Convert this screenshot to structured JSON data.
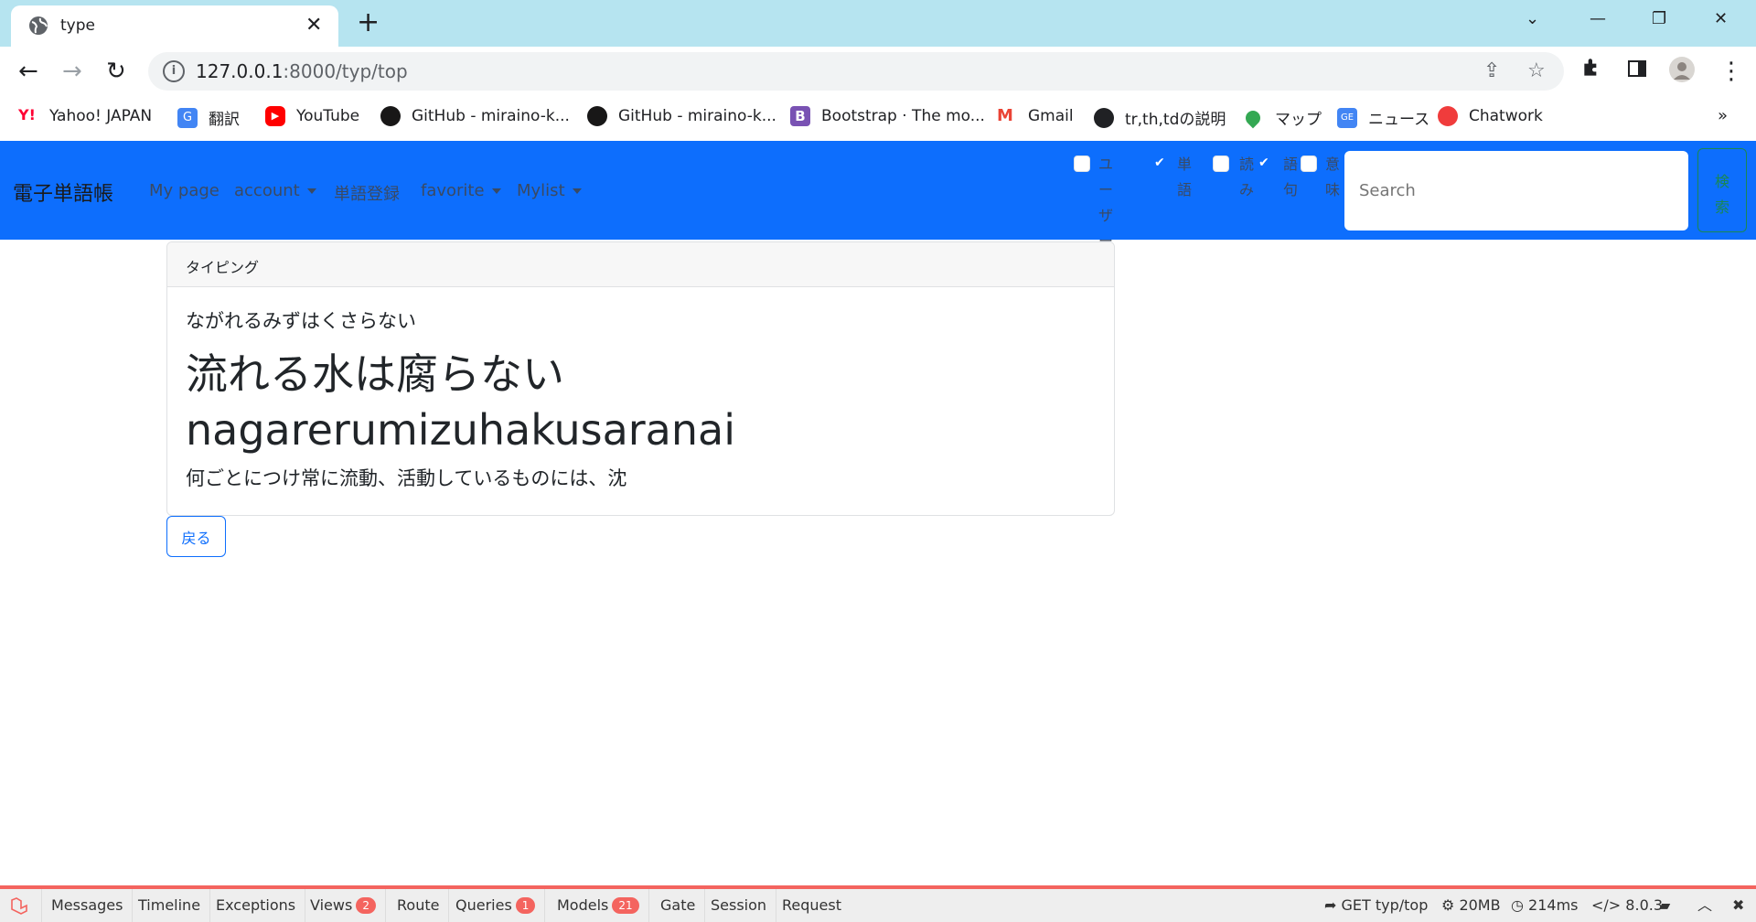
{
  "browser": {
    "tab_title": "type",
    "url_host": "127.0.0.1",
    "url_path": ":8000/typ/top",
    "bookmarks": [
      {
        "label": "Yahoo! JAPAN",
        "icon": "yahoo-icon",
        "color": "#ff0033"
      },
      {
        "label": "翻訳",
        "icon": "translate-icon",
        "color": "#4285f4"
      },
      {
        "label": "YouTube",
        "icon": "youtube-icon",
        "color": "#ff0000"
      },
      {
        "label": "GitHub - miraino-k...",
        "icon": "github-icon",
        "color": "#181717"
      },
      {
        "label": "GitHub - miraino-k...",
        "icon": "github-icon",
        "color": "#181717"
      },
      {
        "label": "Bootstrap · The mo...",
        "icon": "bootstrap-icon",
        "color": "#7952b3"
      },
      {
        "label": "Gmail",
        "icon": "gmail-icon",
        "color": "#ea4335"
      },
      {
        "label": "tr,th,tdの説明",
        "icon": "globe-icon",
        "color": "#202124"
      },
      {
        "label": "マップ",
        "icon": "maps-icon",
        "color": "#34a853"
      },
      {
        "label": "ニュース",
        "icon": "news-icon",
        "color": "#4285f4"
      },
      {
        "label": "Chatwork",
        "icon": "chatwork-icon",
        "color": "#f03c3c"
      }
    ]
  },
  "navbar": {
    "brand": "電子単語帳",
    "links": [
      {
        "label": "My page"
      },
      {
        "label": "account"
      },
      {
        "label": "単語登録"
      },
      {
        "label": "favorite"
      },
      {
        "label": "Mylist"
      }
    ],
    "filters": [
      {
        "label": "ユーザー名",
        "checked": false
      },
      {
        "label": "単語",
        "checked": true
      },
      {
        "label": "読み",
        "checked": false
      },
      {
        "label": "語句",
        "checked": true
      },
      {
        "label": "意味",
        "checked": false
      }
    ],
    "search_placeholder": "Search",
    "search_button": "検索"
  },
  "card": {
    "header": "タイピング",
    "yomi": "ながれるみずはくさらない",
    "word": "流れる水は腐らない",
    "romaji": "nagarerumizuhakusaranai",
    "meaning": "何ごとにつけ常に流動、活動しているものには、沈"
  },
  "back_button": "戻る",
  "debugbar": {
    "tabs": [
      {
        "label": "Messages"
      },
      {
        "label": "Timeline"
      },
      {
        "label": "Exceptions"
      },
      {
        "label": "Views",
        "badge": "2"
      },
      {
        "label": "Route"
      },
      {
        "label": "Queries",
        "badge": "1"
      },
      {
        "label": "Models",
        "badge": "21"
      },
      {
        "label": "Gate"
      },
      {
        "label": "Session"
      },
      {
        "label": "Request"
      }
    ],
    "route": "GET typ/top",
    "memory": "20MB",
    "time": "214ms",
    "php": "8.0.3"
  }
}
